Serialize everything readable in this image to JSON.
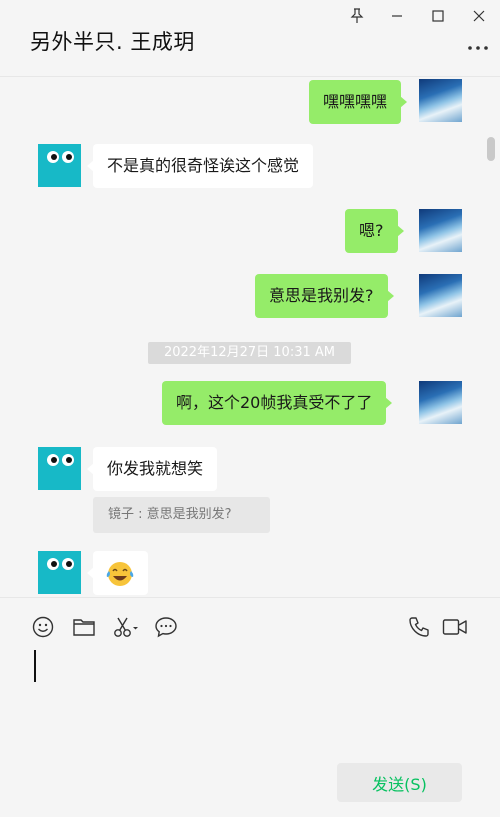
{
  "header": {
    "chat_title": "另外半只. 王成玥"
  },
  "window_controls": {
    "pin_icon": "pin-icon",
    "minimize_icon": "minimize-icon",
    "maximize_icon": "maximize-icon",
    "close_icon": "close-icon",
    "more_icon": "more-icon"
  },
  "messages": [
    {
      "from": "self",
      "text": "嘿嘿嘿嘿"
    },
    {
      "from": "other",
      "text": "不是真的很奇怪诶这个感觉"
    },
    {
      "from": "self",
      "text": "嗯?"
    },
    {
      "from": "self",
      "text": "意思是我别发?"
    },
    {
      "timestamp": "2022年12月27日 10:31 AM"
    },
    {
      "from": "self",
      "text": "啊，这个20帧我真受不了了"
    },
    {
      "from": "other",
      "text": "你发我就想笑",
      "quote": "镜子 : 意思是我别发?"
    },
    {
      "from": "other",
      "text": "😂",
      "emoji": "tears-of-joy"
    }
  ],
  "composer": {
    "tools": [
      "emoji-icon",
      "folder-icon",
      "scissors-icon",
      "chat-history-icon",
      "phone-icon",
      "video-icon"
    ],
    "send_label": "发送(S)"
  },
  "colors": {
    "self_bubble": "#95ec69",
    "other_bubble": "#ffffff",
    "background": "#f5f5f5",
    "send_text": "#07c160",
    "avatar_other": "#17b9c7"
  }
}
